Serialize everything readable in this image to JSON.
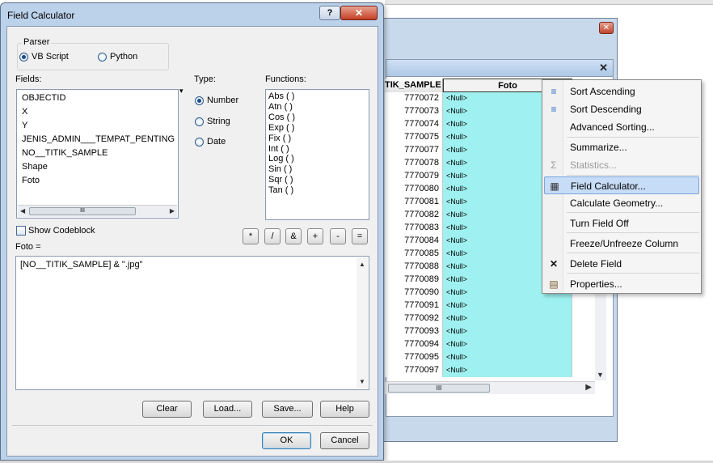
{
  "dialog": {
    "title": "Field Calculator",
    "help_glyph": "?",
    "close_glyph": "✕",
    "parser": {
      "label": "Parser",
      "options": [
        {
          "label": "VB Script",
          "selected": true
        },
        {
          "label": "Python",
          "selected": false
        }
      ]
    },
    "fields_label": "Fields:",
    "fields": [
      "OBJECTID",
      "X",
      "Y",
      "JENIS_ADMIN___TEMPAT_PENTING",
      "NO__TITIK_SAMPLE",
      "Shape",
      "Foto"
    ],
    "type_label": "Type:",
    "types": [
      {
        "label": "Number",
        "selected": true
      },
      {
        "label": "String",
        "selected": false
      },
      {
        "label": "Date",
        "selected": false
      }
    ],
    "functions_label": "Functions:",
    "functions": [
      "Abs ( )",
      "Atn ( )",
      "Cos ( )",
      "Exp ( )",
      "Fix ( )",
      "Int ( )",
      "Log ( )",
      "Sin ( )",
      "Sqr ( )",
      "Tan ( )"
    ],
    "show_codeblock_label": "Show Codeblock",
    "operators": [
      "*",
      "/",
      "&",
      "+",
      "-",
      "="
    ],
    "expression_label": "Foto =",
    "expression": "[NO__TITIK_SAMPLE] & \".jpg\"",
    "buttons": {
      "clear": "Clear",
      "load": "Load...",
      "save": "Save...",
      "help": "Help",
      "ok": "OK",
      "cancel": "Cancel"
    },
    "scroll_grip": "III"
  },
  "table": {
    "close_glyph": "✕",
    "sub_close_glyph": "✕",
    "columns": [
      "TIK_SAMPLE",
      "Foto"
    ],
    "rows": [
      {
        "id": "7770072",
        "foto": "<Null>"
      },
      {
        "id": "7770073",
        "foto": "<Null>"
      },
      {
        "id": "7770074",
        "foto": "<Null>"
      },
      {
        "id": "7770075",
        "foto": "<Null>"
      },
      {
        "id": "7770077",
        "foto": "<Null>"
      },
      {
        "id": "7770078",
        "foto": "<Null>"
      },
      {
        "id": "7770079",
        "foto": "<Null>"
      },
      {
        "id": "7770080",
        "foto": "<Null>"
      },
      {
        "id": "7770081",
        "foto": "<Null>"
      },
      {
        "id": "7770082",
        "foto": "<Null>"
      },
      {
        "id": "7770083",
        "foto": "<Null>"
      },
      {
        "id": "7770084",
        "foto": "<Null>"
      },
      {
        "id": "7770085",
        "foto": "<Null>"
      },
      {
        "id": "7770088",
        "foto": "<Null>"
      },
      {
        "id": "7770089",
        "foto": "<Null>"
      },
      {
        "id": "7770090",
        "foto": "<Null>"
      },
      {
        "id": "7770091",
        "foto": "<Null>"
      },
      {
        "id": "7770092",
        "foto": "<Null>"
      },
      {
        "id": "7770093",
        "foto": "<Null>"
      },
      {
        "id": "7770094",
        "foto": "<Null>"
      },
      {
        "id": "7770095",
        "foto": "<Null>"
      },
      {
        "id": "7770097",
        "foto": "<Null>"
      }
    ],
    "hscroll_grip": "III"
  },
  "context_menu": {
    "items": [
      {
        "label": "Sort Ascending",
        "icon": "sort-ascending-icon",
        "glyph": "≡",
        "enabled": true
      },
      {
        "label": "Sort Descending",
        "icon": "sort-descending-icon",
        "glyph": "≡",
        "enabled": true
      },
      {
        "label": "Advanced Sorting...",
        "icon": "",
        "glyph": "",
        "enabled": true
      },
      {
        "label": "Summarize...",
        "icon": "",
        "glyph": "",
        "enabled": true
      },
      {
        "label": "Statistics...",
        "icon": "sigma-icon",
        "glyph": "Σ",
        "enabled": false
      },
      {
        "label": "Field Calculator...",
        "icon": "calculator-icon",
        "glyph": "▦",
        "enabled": true,
        "highlighted": true
      },
      {
        "label": "Calculate Geometry...",
        "icon": "",
        "glyph": "",
        "enabled": true
      },
      {
        "label": "Turn Field Off",
        "icon": "",
        "glyph": "",
        "enabled": true
      },
      {
        "label": "Freeze/Unfreeze Column",
        "icon": "",
        "glyph": "",
        "enabled": true
      },
      {
        "label": "Delete Field",
        "icon": "delete-icon",
        "glyph": "✕",
        "enabled": true
      },
      {
        "label": "Properties...",
        "icon": "properties-icon",
        "glyph": "▤",
        "enabled": true
      }
    ]
  },
  "colors": {
    "selected_column": "#9ff0f0",
    "menu_highlight": "#c7dcf6",
    "close_button": "#c43e24"
  }
}
